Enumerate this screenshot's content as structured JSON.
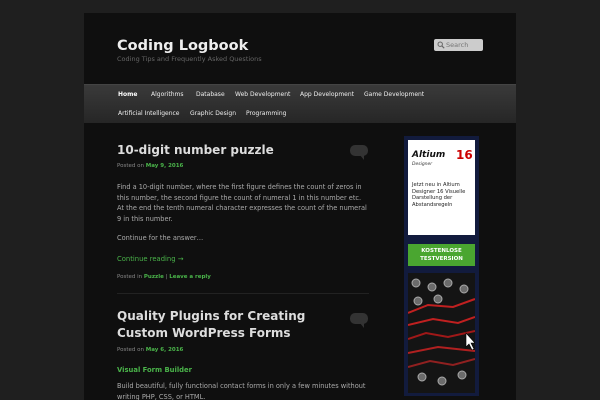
{
  "site": {
    "title": "Coding Logbook",
    "description": "Coding Tips and Frequently Asked Questions"
  },
  "search": {
    "placeholder": "Search"
  },
  "menu": {
    "row1": [
      "Home",
      "Algorithms",
      "Database",
      "Web Development",
      "App Development",
      "Game Development"
    ],
    "row2": [
      "Artificial Intelligence",
      "Graphic Design",
      "Programming"
    ]
  },
  "posts": [
    {
      "title": "10-digit number puzzle",
      "posted_prefix": "Posted on",
      "date": "May 9, 2016",
      "body": "Find a 10-digit number, where the first figure defines the count of zeros in this number, the second figure the count of numeral 1 in this number etc. At the end the tenth numeral character expresses the count of the numeral 9 in this number.",
      "continue": "Continue for the answer…",
      "more_link": "Continue reading →",
      "posted_in": "Posted in",
      "category": "Puzzle",
      "reply": "Leave a reply"
    },
    {
      "title_line1": "Quality Plugins for Creating",
      "title_line2": "Custom WordPress Forms",
      "posted_prefix": "Posted on",
      "date": "May 6, 2016",
      "subheading": "Visual Form Builder",
      "body": "Build beautiful, fully functional contact forms in only a few minutes without writing PHP, CSS, or HTML."
    }
  ],
  "ad": {
    "logo": "Altium",
    "version": "16",
    "sub": "Designer",
    "text": "Jetzt neu in Altium Designer 16 Visuelle Darstellung der Abstandsregeln",
    "cta_line1": "KOSTENLOSE",
    "cta_line2": "TESTVERSION"
  },
  "colors": {
    "accent": "#4ab44a",
    "background": "#1f1f1f",
    "page": "#0f0f0f"
  }
}
